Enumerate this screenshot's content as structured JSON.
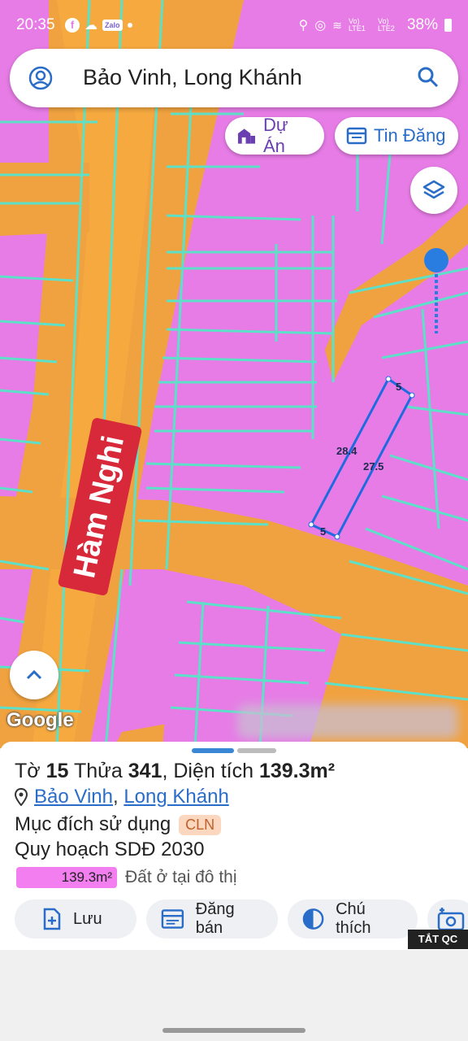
{
  "status": {
    "time": "20:35",
    "battery": "38%",
    "lte1": "Vo) LTE1",
    "lte2": "Vo) LTE2",
    "zalo": "Zalo"
  },
  "search": {
    "title": "Bảo Vinh, Long Khánh"
  },
  "chips": {
    "du_an": "Dự Án",
    "tin_dang": "Tin Đăng"
  },
  "map": {
    "road_name": "Hàm Nghi",
    "logo": "Google",
    "plot_labels": [
      "5",
      "28.4",
      "27.5",
      "5"
    ]
  },
  "colors": {
    "residential": "#e77ce6",
    "road": "#f1a240",
    "parcel_line": "#5de0c8",
    "plot_outline": "#1e6be0"
  },
  "sheet": {
    "to_label": "Tờ",
    "to_value": "15",
    "thua_label": "Thửa",
    "thua_value": "341",
    "area_label": ", Diện tích",
    "area_value": "139.3m²",
    "ward": "Bảo Vinh",
    "separator": ",",
    "district": "Long Khánh",
    "purpose_label": "Mục đích sử dụng",
    "purpose_code": "CLN",
    "plan_label": "Quy hoạch SDĐ 2030",
    "plan_area": "139.3m²",
    "plan_desc": "Đất ở tại đô thị"
  },
  "actions": {
    "save": "Lưu",
    "post": "Đăng bán",
    "legend": "Chú thích"
  },
  "ad": {
    "label": "TẮT QC"
  }
}
